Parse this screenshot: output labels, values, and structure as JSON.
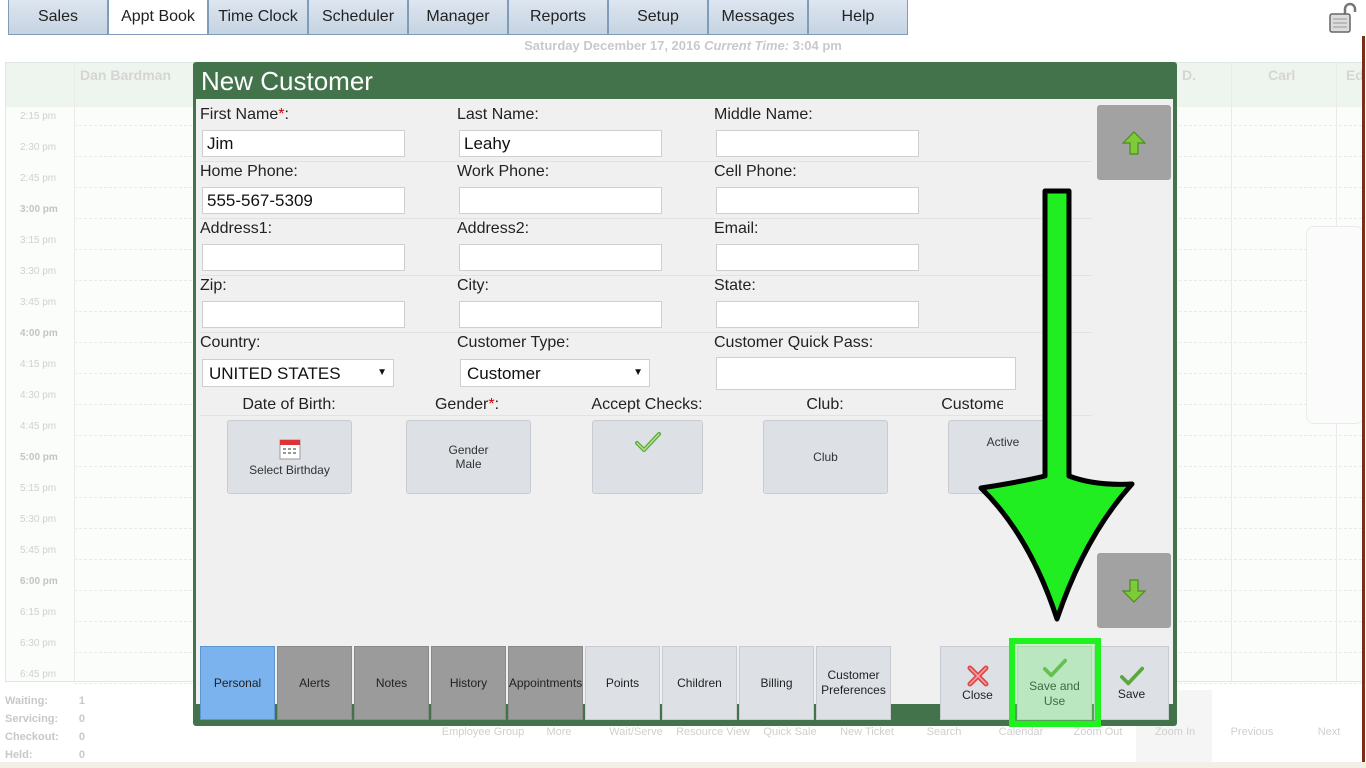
{
  "nav": {
    "tabs": [
      "Sales",
      "Appt Book",
      "Time Clock",
      "Scheduler",
      "Manager",
      "Reports",
      "Setup",
      "Messages",
      "Help"
    ],
    "active": "Appt Book"
  },
  "datebar": {
    "date": "Saturday December 17, 2016",
    "time_label": "Current Time:",
    "time": "3:04 pm"
  },
  "schedule": {
    "employees": [
      "Dan Bardman",
      "D.",
      "Carl",
      "Ed"
    ],
    "times": [
      "2:15 pm",
      "2:30 pm",
      "2:45 pm",
      "3:00 pm",
      "3:15 pm",
      "3:30 pm",
      "3:45 pm",
      "4:00 pm",
      "4:15 pm",
      "4:30 pm",
      "4:45 pm",
      "5:00 pm",
      "5:15 pm",
      "5:30 pm",
      "5:45 pm",
      "6:00 pm",
      "6:15 pm",
      "6:30 pm",
      "6:45 pm"
    ]
  },
  "stats": [
    {
      "label": "Waiting:",
      "value": "1"
    },
    {
      "label": "Servicing:",
      "value": "0"
    },
    {
      "label": "Checkout:",
      "value": "0"
    },
    {
      "label": "Held:",
      "value": "0"
    }
  ],
  "bottom_toolbar": [
    "Employee Group",
    "More",
    "Wait/Serve",
    "Resource View",
    "Quick Sale",
    "New Ticket",
    "Search",
    "Calendar",
    "Zoom Out",
    "Zoom In",
    "Previous",
    "Next"
  ],
  "modal": {
    "title": "New Customer",
    "fields": {
      "first_name": {
        "label": "First Name",
        "value": "Jim"
      },
      "last_name": {
        "label": "Last Name:",
        "value": "Leahy"
      },
      "middle_name": {
        "label": "Middle Name:",
        "value": ""
      },
      "home_phone": {
        "label": "Home Phone:",
        "value": "555-567-5309"
      },
      "work_phone": {
        "label": "Work Phone:",
        "value": ""
      },
      "cell_phone": {
        "label": "Cell Phone:",
        "value": ""
      },
      "address1": {
        "label": "Address1:",
        "value": ""
      },
      "address2": {
        "label": "Address2:",
        "value": ""
      },
      "email": {
        "label": "Email:",
        "value": ""
      },
      "zip": {
        "label": "Zip:",
        "value": ""
      },
      "city": {
        "label": "City:",
        "value": ""
      },
      "state": {
        "label": "State:",
        "value": ""
      },
      "country": {
        "label": "Country:",
        "value": "UNITED STATES"
      },
      "customer_type": {
        "label": "Customer Type:",
        "value": "Customer"
      },
      "quick_pass": {
        "label": "Customer Quick Pass:",
        "value": ""
      }
    },
    "tiles": {
      "dob": {
        "label": "Date of Birth:",
        "button": "Select Birthday"
      },
      "gender": {
        "label": "Gender",
        "button_line1": "Gender",
        "button_line2": "Male"
      },
      "accept_checks": {
        "label": "Accept Checks:"
      },
      "club": {
        "label": "Club:",
        "button": "Club"
      },
      "status": {
        "label": "Customer Status:",
        "button": "Active"
      }
    },
    "footer_tabs": [
      "Personal",
      "Alerts",
      "Notes",
      "History",
      "Appointments",
      "Points",
      "Children",
      "Billing",
      "Customer Preferences"
    ],
    "actions": {
      "close": "Close",
      "save_and_use": "Save and Use",
      "save": "Save"
    }
  },
  "colors": {
    "modal_green": "#43734a",
    "active_tab_blue": "#7ab3ee",
    "highlight_green": "#1ff21f"
  }
}
